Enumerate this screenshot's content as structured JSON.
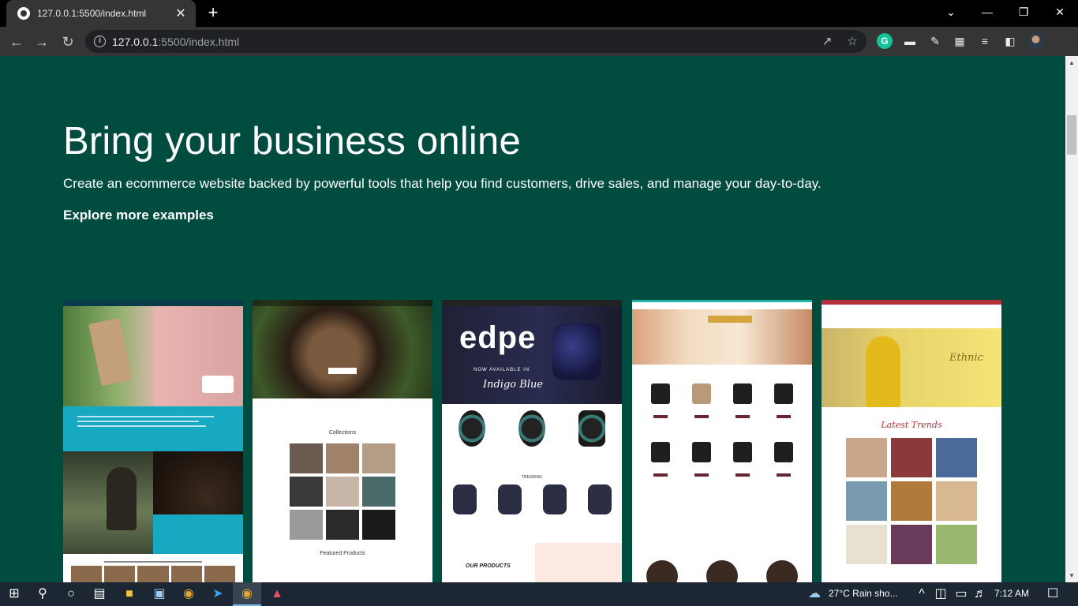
{
  "browser": {
    "tab_title": "127.0.0.1:5500/index.html",
    "url_host": "127.0.0.1",
    "url_rest": ":5500/index.html",
    "new_tab": "+",
    "close_tab": "✕",
    "minimize": "—",
    "restore": "❐",
    "close_window": "✕",
    "tab_search": "⌄"
  },
  "page": {
    "hero_title": "Bring your business online",
    "hero_subtitle": "Create an ecommerce website backed by powerful tools that help you find customers, drive sales, and manage your day-to-day.",
    "explore_link": "Explore more examples",
    "card2_collections": "Collections",
    "card2_featured": "Featured Products",
    "card3_logo": "edpe",
    "card3_tagline": "NOW AVAILABLE IN",
    "card3_script": "Indigo Blue",
    "card3_trending": "TRENDING",
    "card3_products": "OUR PRODUCTS",
    "card5_ethnic": "Ethnic",
    "card5_latest": "Latest Trends"
  },
  "taskbar": {
    "weather": "27°C  Rain sho...",
    "time": "7:12 AM"
  },
  "colors": {
    "page_bg": "#004c3f",
    "chrome_bg": "#353535",
    "tabstrip_bg": "#000000",
    "taskbar_bg": "#1d2733"
  }
}
